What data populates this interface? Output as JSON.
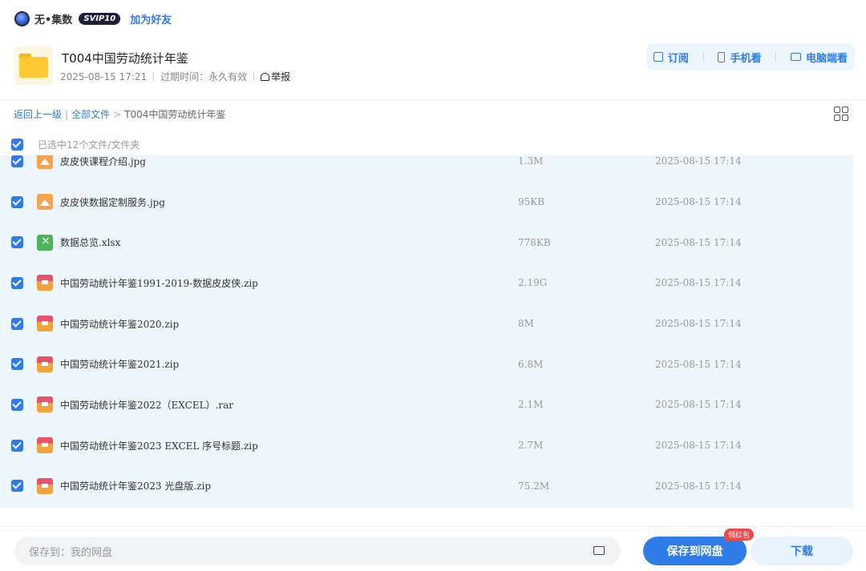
{
  "topbar": {
    "brand": "无•集数",
    "vip_badge": "SVIP10",
    "add_friend": "加为好友"
  },
  "header": {
    "title": "T004中国劳动统计年鉴",
    "date": "2025-08-15 17:21",
    "expire": "过期时间：永久有效",
    "report": "举报"
  },
  "actions": {
    "subscribe": "订阅",
    "mobile": "手机看",
    "desktop": "电脑端看"
  },
  "breadcrumb": {
    "back": "返回上一级",
    "separator": "|",
    "all_files": "全部文件",
    "arrow": ">",
    "current": "T004中国劳动统计年鉴"
  },
  "selection": {
    "text": "已选中12个文件/文件夹"
  },
  "files": [
    {
      "name": "皮皮侠课程介绍.jpg",
      "size": "1.3M",
      "date": "2025-08-15 17:14",
      "type": "image-icon",
      "checked": true
    },
    {
      "name": "皮皮侠数据定制服务.jpg",
      "size": "95KB",
      "date": "2025-08-15 17:14",
      "type": "image-icon",
      "checked": true
    },
    {
      "name": "数据总览.xlsx",
      "size": "778KB",
      "date": "2025-08-15 17:14",
      "type": "excel-icon",
      "checked": true
    },
    {
      "name": "中国劳动统计年鉴1991-2019-数据皮皮侠.zip",
      "size": "2.19G",
      "date": "2025-08-15 17:14",
      "type": "archive-icon",
      "checked": true
    },
    {
      "name": "中国劳动统计年鉴2020.zip",
      "size": "8M",
      "date": "2025-08-15 17:14",
      "type": "archive-icon",
      "checked": true
    },
    {
      "name": "中国劳动统计年鉴2021.zip",
      "size": "6.8M",
      "date": "2025-08-15 17:14",
      "type": "archive-icon",
      "checked": true
    },
    {
      "name": "中国劳动统计年鉴2022（EXCEL）.rar",
      "size": "2.1M",
      "date": "2025-08-15 17:14",
      "type": "archive-icon",
      "checked": true
    },
    {
      "name": "中国劳动统计年鉴2023 EXCEL 序号标题.zip",
      "size": "2.7M",
      "date": "2025-08-15 17:14",
      "type": "archive-icon",
      "checked": true
    },
    {
      "name": "中国劳动统计年鉴2023 光盘版.zip",
      "size": "75.2M",
      "date": "2025-08-15 17:14",
      "type": "archive-icon",
      "checked": true
    }
  ],
  "bottom": {
    "save_path": "保存到：我的网盘",
    "save_button": "保存到网盘",
    "red_packet": "领红包",
    "download_button": "下载"
  },
  "colors": {
    "accent": "#2f7ce9",
    "list_bg": "#eef6fd",
    "badge_red": "#f04848"
  }
}
